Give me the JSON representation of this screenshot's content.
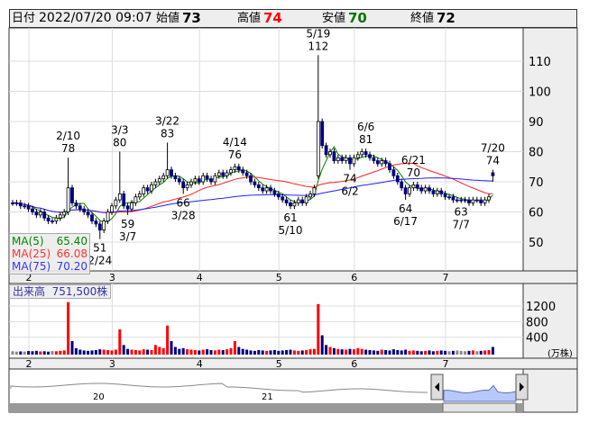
{
  "header": {
    "date_label": "日付",
    "date": "2022/07/20 09:07",
    "open_label": "始値",
    "open": "73",
    "high_label": "高値",
    "high": "74",
    "low_label": "安値",
    "low": "70",
    "close_label": "終値",
    "close": "72"
  },
  "colors": {
    "up": "#ff0000",
    "down": "#000080",
    "ma5": "#008000",
    "ma25": "#ff2020",
    "ma75": "#2020ff",
    "high": "#ff0000",
    "low": "#007000"
  },
  "price_axis": [
    110,
    100,
    90,
    80,
    70,
    60,
    50
  ],
  "volume_axis": [
    1200,
    800,
    400
  ],
  "volume_unit": "(万株)",
  "months": [
    {
      "label": "2",
      "i": 5
    },
    {
      "label": "3",
      "i": 26
    },
    {
      "label": "4",
      "i": 48
    },
    {
      "label": "5",
      "i": 68
    },
    {
      "label": "6",
      "i": 87
    },
    {
      "label": "7",
      "i": 110
    }
  ],
  "legend": [
    {
      "name": "MA(5)",
      "value": "65.40"
    },
    {
      "name": "MA(25)",
      "value": "66.08"
    },
    {
      "name": "MA(75)",
      "value": "70.20"
    }
  ],
  "volume_label": "出来高",
  "volume_value": "751,500株",
  "navigator": {
    "year_labels": [
      "20",
      "21"
    ]
  },
  "closes": [
    63,
    63,
    62,
    62,
    61,
    60,
    59,
    60,
    58,
    57,
    57,
    58,
    59,
    60,
    68,
    63,
    62,
    61,
    60,
    59,
    57,
    56,
    54,
    57,
    60,
    62,
    64,
    66,
    62,
    61,
    63,
    65,
    66,
    68,
    67,
    69,
    70,
    71,
    72,
    74,
    72,
    71,
    70,
    68,
    69,
    70,
    71,
    70,
    72,
    71,
    70,
    72,
    73,
    72,
    73,
    74,
    75,
    74,
    73,
    72,
    70,
    69,
    68,
    67,
    68,
    67,
    66,
    65,
    64,
    63,
    62,
    63,
    64,
    63,
    65,
    66,
    68,
    90,
    82,
    79,
    80,
    77,
    78,
    77,
    78,
    76,
    78,
    79,
    80,
    79,
    78,
    77,
    76,
    77,
    76,
    74,
    72,
    70,
    68,
    66,
    68,
    69,
    68,
    67,
    68,
    67,
    66,
    67,
    66,
    65,
    65,
    64,
    64,
    64,
    64,
    63,
    64,
    64,
    63,
    64,
    65,
    72
  ],
  "highs": {
    "14": 78,
    "27": 80,
    "39": 83,
    "56": 76,
    "77": 112,
    "89": 81,
    "101": 70,
    "121": 74
  },
  "lows": {
    "22": 51,
    "29": 59,
    "43": 66,
    "70": 61,
    "85": 74,
    "99": 64,
    "113": 63,
    "121": 70
  },
  "opens": {
    "77": 72,
    "121": 73
  },
  "volumes": [
    40,
    30,
    35,
    30,
    45,
    40,
    50,
    35,
    40,
    30,
    45,
    40,
    50,
    60,
    1300,
    300,
    120,
    80,
    60,
    50,
    60,
    70,
    90,
    80,
    70,
    60,
    80,
    600,
    200,
    100,
    80,
    70,
    60,
    90,
    80,
    70,
    200,
    150,
    120,
    700,
    300,
    150,
    100,
    120,
    90,
    80,
    70,
    60,
    80,
    90,
    70,
    60,
    80,
    70,
    90,
    120,
    300,
    150,
    100,
    80,
    60,
    50,
    70,
    60,
    50,
    60,
    70,
    50,
    60,
    70,
    80,
    60,
    50,
    60,
    70,
    90,
    100,
    1250,
    450,
    200,
    150,
    120,
    100,
    90,
    80,
    100,
    90,
    120,
    100,
    80,
    70,
    60,
    50,
    80,
    70,
    60,
    90,
    70,
    60,
    80,
    50,
    60,
    50,
    40,
    50,
    60,
    40,
    50,
    60,
    50,
    40,
    50,
    60,
    50,
    40,
    50,
    60,
    40,
    50,
    60,
    70,
    150
  ],
  "annotations": [
    {
      "i": 14,
      "date": "2/10",
      "value": "78",
      "pos": "above"
    },
    {
      "i": 22,
      "date": "2/24",
      "value": "51",
      "pos": "below"
    },
    {
      "i": 27,
      "date": "3/3",
      "value": "80",
      "pos": "above"
    },
    {
      "i": 29,
      "date": "3/7",
      "value": "59",
      "pos": "below"
    },
    {
      "i": 39,
      "date": "3/22",
      "value": "83",
      "pos": "above"
    },
    {
      "i": 43,
      "date": "3/28",
      "value": "66",
      "pos": "below"
    },
    {
      "i": 56,
      "date": "4/14",
      "value": "76",
      "pos": "above"
    },
    {
      "i": 70,
      "date": "5/10",
      "value": "61",
      "pos": "below"
    },
    {
      "i": 77,
      "date": "5/19",
      "value": "112",
      "pos": "above"
    },
    {
      "i": 85,
      "date": "6/2",
      "value": "74",
      "pos": "below"
    },
    {
      "i": 89,
      "date": "6/6",
      "value": "81",
      "pos": "above"
    },
    {
      "i": 99,
      "date": "6/17",
      "value": "64",
      "pos": "below"
    },
    {
      "i": 101,
      "date": "6/21",
      "value": "70",
      "pos": "above"
    },
    {
      "i": 113,
      "date": "7/7",
      "value": "63",
      "pos": "below"
    },
    {
      "i": 121,
      "date": "7/20",
      "value": "74",
      "pos": "above"
    }
  ]
}
